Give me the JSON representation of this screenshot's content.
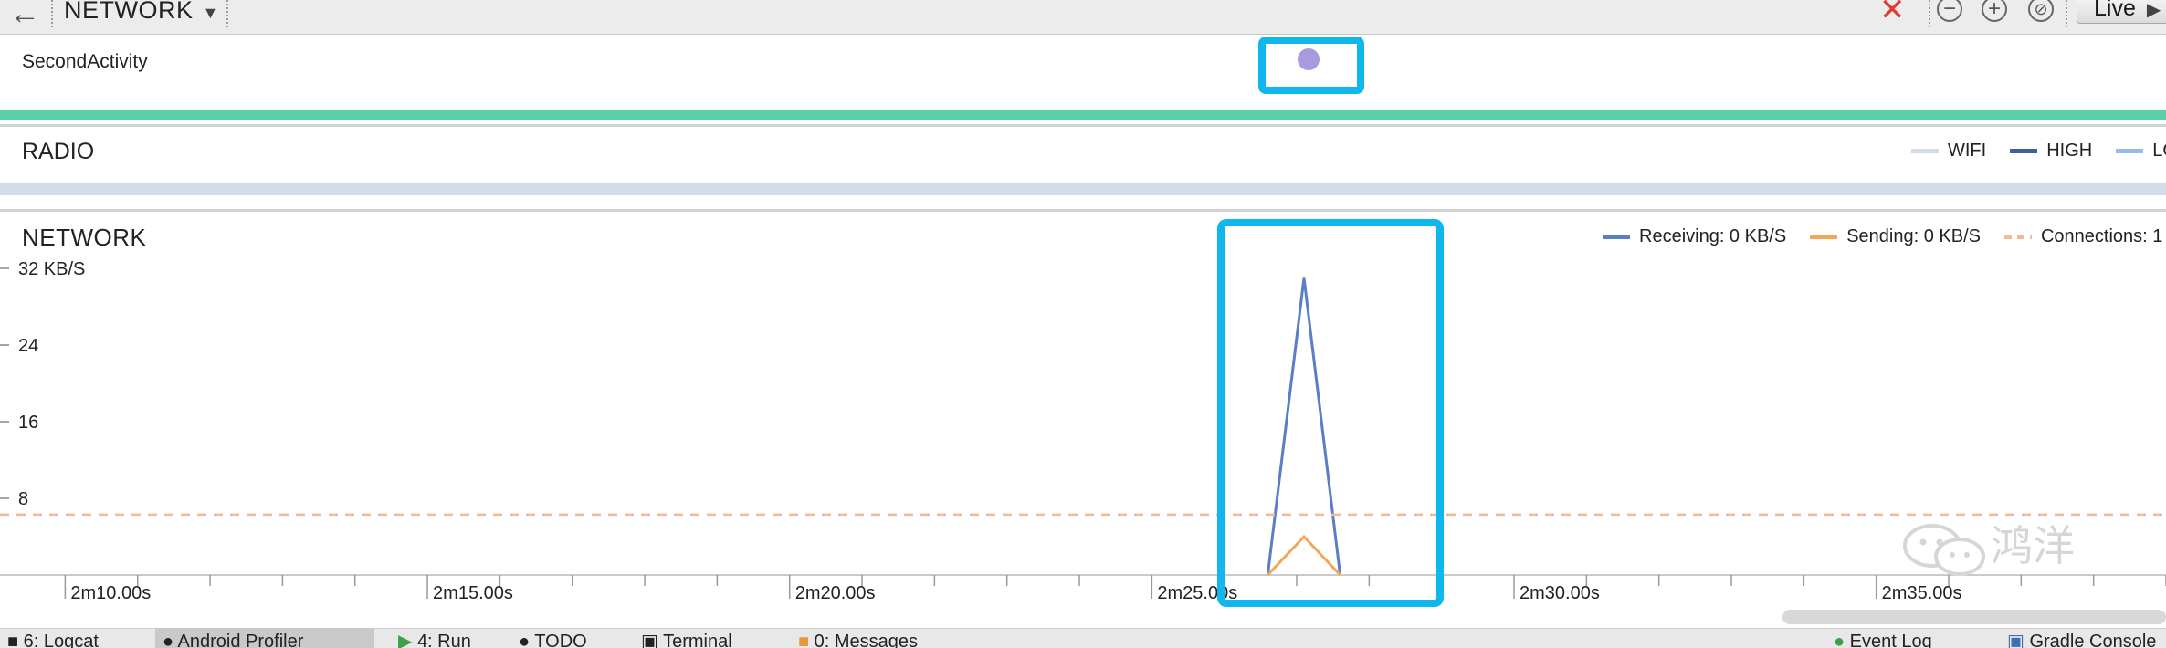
{
  "toolbar": {
    "back_icon": "arrow-left-icon",
    "profiler_label": "NETWORK",
    "stop_icon": "close-x-icon",
    "zoom_out_icon": "minus-circle-icon",
    "zoom_in_icon": "plus-circle-icon",
    "reset_zoom_icon": "reset-circle-icon",
    "live_label": "Live"
  },
  "events": {
    "activity_label": "SecondActivity",
    "activity_color": "#5bcfa8",
    "event_dot_color": "#a99ae0"
  },
  "radio": {
    "title": "RADIO",
    "legend": [
      {
        "label": "WIFI",
        "color": "#d2dce8"
      },
      {
        "label": "HIGH",
        "color": "#3d5fa3"
      },
      {
        "label": "LOW",
        "color": "#9ab8f0"
      }
    ]
  },
  "network": {
    "title": "NETWORK",
    "legend": [
      {
        "label": "Receiving: 0 KB/S",
        "color": "#5b7fc4",
        "style": "solid"
      },
      {
        "label": "Sending: 0 KB/S",
        "color": "#f2a65a",
        "style": "solid"
      },
      {
        "label": "Connections: 1",
        "color": "#f2b999",
        "style": "dashed"
      }
    ]
  },
  "chart_data": {
    "type": "line",
    "title": "NETWORK",
    "ylabel": "",
    "xlabel": "",
    "yunit_label": "32 KB/S",
    "y_ticks": [
      {
        "value": 32,
        "label": "32 KB/S"
      },
      {
        "value": 24,
        "label": "24"
      },
      {
        "value": 16,
        "label": "16"
      },
      {
        "value": 8,
        "label": "8"
      }
    ],
    "ylim": [
      0,
      32
    ],
    "x_ticks": [
      "2m10.00s",
      "2m15.00s",
      "2m20.00s",
      "2m25.00s",
      "2m30.00s",
      "2m35.00s"
    ],
    "x_tick_values": [
      130,
      135,
      140,
      145,
      150,
      155
    ],
    "xlim": [
      129.1,
      159.0
    ],
    "series": [
      {
        "name": "Receiving",
        "color": "#5b7fc4",
        "dash": false,
        "x": [
          146.6,
          147.1,
          147.6
        ],
        "y": [
          0,
          31,
          0
        ]
      },
      {
        "name": "Sending",
        "color": "#f2a65a",
        "dash": false,
        "x": [
          146.6,
          147.1,
          147.6
        ],
        "y": [
          0,
          4,
          0
        ]
      },
      {
        "name": "Connections",
        "color": "#f2b999",
        "dash": true,
        "x": [
          129.1,
          159.0
        ],
        "y": [
          6.3,
          6.3
        ]
      }
    ]
  },
  "bottom_tabs": [
    {
      "label": "6: Logcat",
      "icon": "logcat-icon"
    },
    {
      "label": "Android Profiler",
      "icon": "profiler-icon",
      "active": true
    },
    {
      "label": "4: Run",
      "icon": "run-icon"
    },
    {
      "label": "TODO",
      "icon": "todo-icon"
    },
    {
      "label": "Terminal",
      "icon": "terminal-icon"
    },
    {
      "label": "0: Messages",
      "icon": "messages-icon"
    },
    {
      "label": "Event Log",
      "icon": "event-log-icon"
    },
    {
      "label": "Gradle Console",
      "icon": "gradle-icon"
    }
  ],
  "watermark": {
    "text": "鸿洋"
  }
}
